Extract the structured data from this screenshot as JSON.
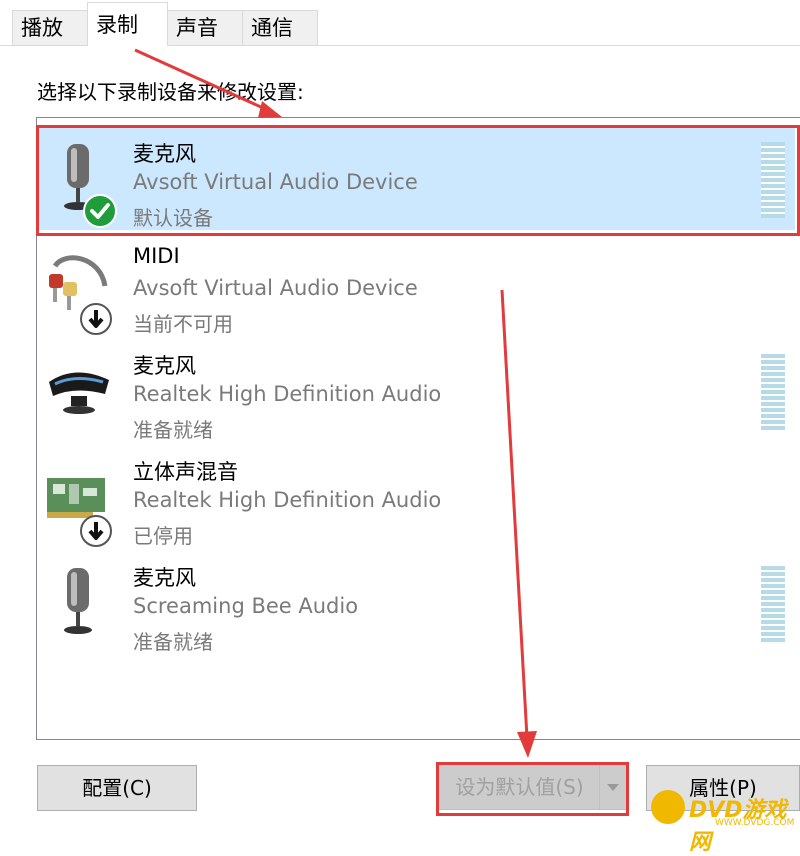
{
  "tabs": [
    {
      "label": "播放"
    },
    {
      "label": "录制"
    },
    {
      "label": "声音"
    },
    {
      "label": "通信"
    }
  ],
  "instruction": "选择以下录制设备来修改设置:",
  "devices": [
    {
      "name": "麦克风",
      "description": "Avsoft Virtual Audio Device",
      "status": "默认设备",
      "icon": "microphone-icon",
      "badge": "default-check-icon"
    },
    {
      "name": "MIDI",
      "description": "Avsoft Virtual Audio Device",
      "status": "当前不可用",
      "icon": "audio-cable-icon",
      "badge": "down-arrow-icon"
    },
    {
      "name": "麦克风",
      "description": "Realtek High Definition Audio",
      "status": "准备就绪",
      "icon": "webcam-icon"
    },
    {
      "name": "立体声混音",
      "description": "Realtek High Definition Audio",
      "status": "已停用",
      "icon": "sound-card-icon",
      "badge": "down-arrow-icon"
    },
    {
      "name": "麦克风",
      "description": "Screaming Bee Audio",
      "status": "准备就绪",
      "icon": "microphone-icon"
    }
  ],
  "buttons": {
    "configure": "配置(C)",
    "set_default": "设为默认值(S)",
    "properties": "属性(P)"
  },
  "watermark": {
    "text": "DVD游戏网",
    "sub": "WWW.DVDG.COM"
  },
  "colors": {
    "selected_row": "#cce8ff",
    "annotation_red": "#e23b3b",
    "meter": "#b7dbe6"
  }
}
